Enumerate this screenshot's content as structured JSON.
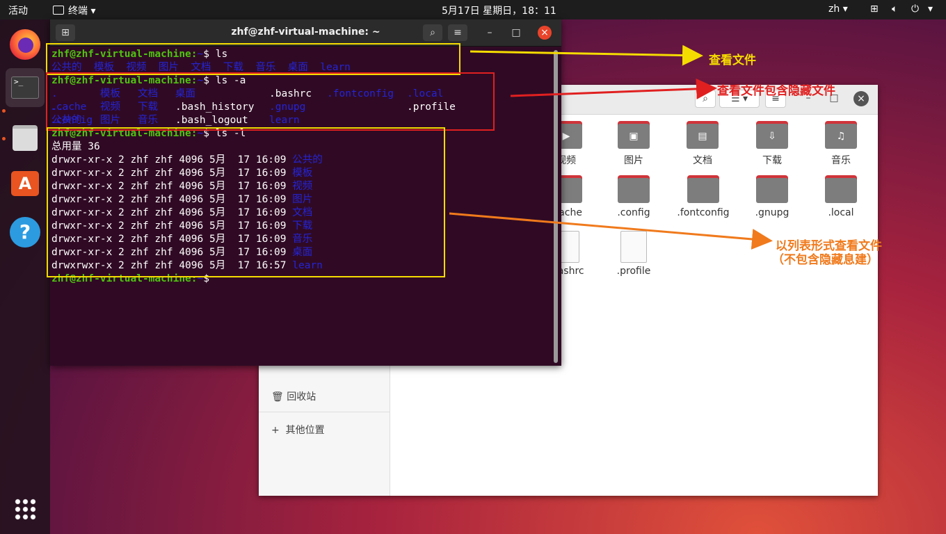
{
  "topbar": {
    "activities": "活动",
    "app_name": "终端",
    "clock": "5月17日 星期日，18：11",
    "language": "zh"
  },
  "dock": {
    "items": [
      "firefox-icon",
      "terminal-icon",
      "files-icon",
      "app-store-icon",
      "help-icon"
    ],
    "show_apps": "app-grid-icon"
  },
  "terminal": {
    "title": "zhf@zhf-virtual-machine: ~",
    "prompt": "zhf@zhf-virtual-machine:",
    "prompt_suffix": "~",
    "commands": {
      "ls": "$ ls",
      "ls_a": "$ ls -a",
      "ls_l": "$ ls -l",
      "empty": "$"
    },
    "ls_output": [
      "公共的",
      "模板",
      "视频",
      "图片",
      "文档",
      "下载",
      "音乐",
      "桌面",
      "learn"
    ],
    "ls_a_rows": [
      [
        ".",
        "模板",
        "文档",
        "桌面",
        "",
        ".bashrc",
        ".fontconfig",
        ".local"
      ],
      [
        "..",
        "视频",
        "下载",
        ".bash_history",
        ".cache",
        ".gnupg",
        "",
        ".profile"
      ],
      [
        "公共的",
        "图片",
        "音乐",
        ".bash_logout",
        ".config",
        "learn",
        "",
        ""
      ]
    ],
    "total": "总用量 36",
    "ls_l_rows": [
      {
        "perm": "drwxr-xr-x 2 zhf zhf 4096 5月  17 16:09 ",
        "name": "公共的"
      },
      {
        "perm": "drwxr-xr-x 2 zhf zhf 4096 5月  17 16:09 ",
        "name": "模板"
      },
      {
        "perm": "drwxr-xr-x 2 zhf zhf 4096 5月  17 16:09 ",
        "name": "视频"
      },
      {
        "perm": "drwxr-xr-x 2 zhf zhf 4096 5月  17 16:09 ",
        "name": "图片"
      },
      {
        "perm": "drwxr-xr-x 2 zhf zhf 4096 5月  17 16:09 ",
        "name": "文档"
      },
      {
        "perm": "drwxr-xr-x 2 zhf zhf 4096 5月  17 16:09 ",
        "name": "下载"
      },
      {
        "perm": "drwxr-xr-x 2 zhf zhf 4096 5月  17 16:09 ",
        "name": "音乐"
      },
      {
        "perm": "drwxr-xr-x 2 zhf zhf 4096 5月  17 16:09 ",
        "name": "桌面"
      },
      {
        "perm": "drwxrwxr-x 2 zhf zhf 4096 5月  17 16:57 ",
        "name": "learn"
      }
    ]
  },
  "files": {
    "row1": [
      {
        "name": "视频",
        "icon": "video-folder-icon"
      },
      {
        "name": "图片",
        "icon": "pictures-folder-icon"
      },
      {
        "name": "文档",
        "icon": "documents-folder-icon"
      },
      {
        "name": "下载",
        "icon": "download-folder-icon"
      },
      {
        "name": "音乐",
        "icon": "music-folder-icon"
      }
    ],
    "row2": [
      ".cache",
      ".config",
      ".fontconfig",
      ".gnupg",
      ".local"
    ],
    "row3": [
      ".bashrc",
      ".profile"
    ],
    "sidebar": {
      "trash": "回收站",
      "other_locations": "其他位置"
    }
  },
  "annotations": {
    "view_files": "查看文件",
    "view_hidden": "查看文件包含隐藏文件",
    "list_format": "以列表形式查看文件",
    "list_format_note": "（不包含隐藏息建）",
    "colors": {
      "yellow": "#f5dc00",
      "red": "#e02020",
      "orange": "#f07a1c"
    }
  }
}
